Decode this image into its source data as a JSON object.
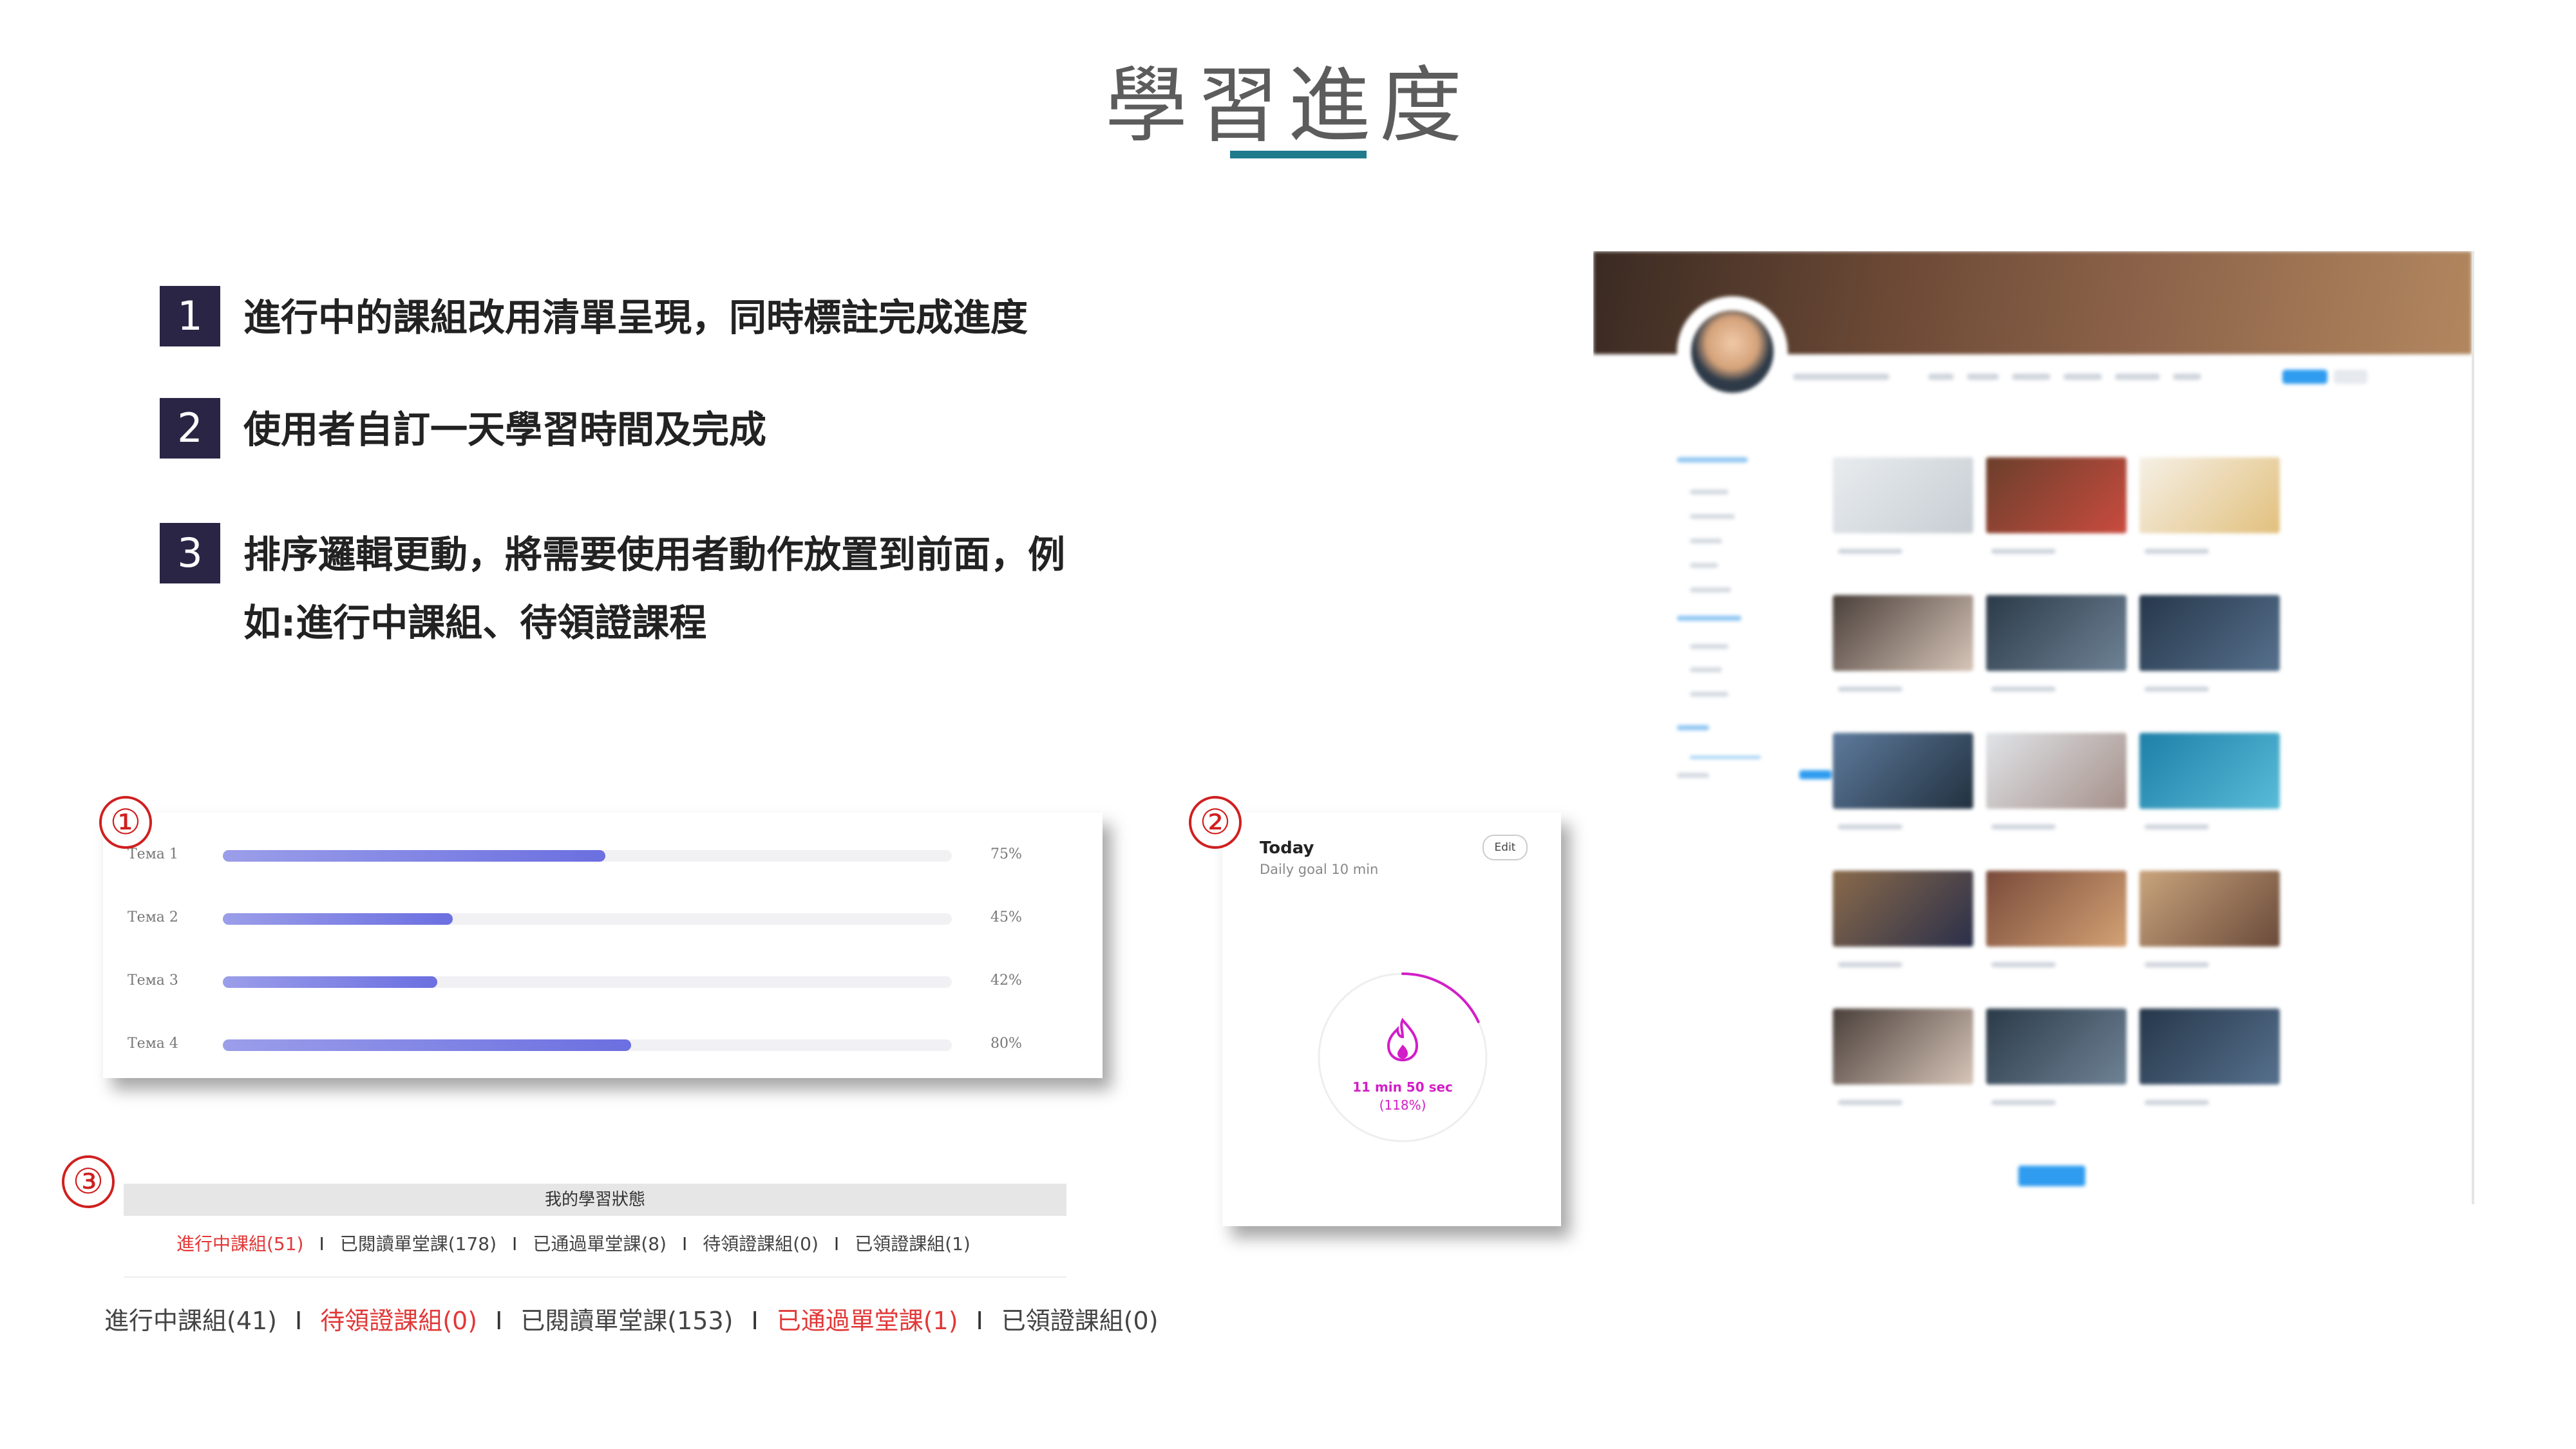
{
  "title": "學習進度",
  "bullets": [
    {
      "num": "1",
      "lines": [
        "進行中的課組改用清單呈現，同時標註完成進度"
      ]
    },
    {
      "num": "2",
      "lines": [
        "使用者自訂一天學習時間及完成"
      ]
    },
    {
      "num": "3",
      "lines": [
        "排序邏輯更動，將需要使用者動作放置到前面，例",
        "如:進行中課組、待領證課程"
      ]
    }
  ],
  "markers": {
    "one": "①",
    "two": "②",
    "three": "③"
  },
  "progress": {
    "rows": [
      {
        "label": "Тема 1",
        "value": 75,
        "pct": "75%"
      },
      {
        "label": "Тема 2",
        "value": 45,
        "pct": "45%"
      },
      {
        "label": "Тема 3",
        "value": 42,
        "pct": "42%"
      },
      {
        "label": "Тема 4",
        "value": 80,
        "pct": "80%"
      }
    ],
    "bar_colors": [
      "#9b9ee9",
      "#6b6fe0"
    ]
  },
  "today": {
    "title": "Today",
    "goal": "Daily goal 10 min",
    "edit_label": "Edit",
    "time": "11 min 50 sec",
    "percent": "(118%)",
    "ring_progress": 0.18,
    "accent": "#d21ec7",
    "icon": "flame-icon"
  },
  "status": {
    "header": "我的學習狀態",
    "old_tabs": [
      {
        "label": "進行中課組(51)",
        "highlight": true
      },
      {
        "label": "已閱讀單堂課(178)",
        "highlight": false
      },
      {
        "label": "已通過單堂課(8)",
        "highlight": false
      },
      {
        "label": "待領證課組(0)",
        "highlight": false
      },
      {
        "label": "已領證課組(1)",
        "highlight": false
      }
    ],
    "new_tabs": [
      {
        "label": "進行中課組(41)",
        "highlight": false
      },
      {
        "label": "待領證課組(0)",
        "highlight": true
      },
      {
        "label": "已閱讀單堂課(153)",
        "highlight": false
      },
      {
        "label": "已通過單堂課(1)",
        "highlight": true
      },
      {
        "label": "已領證課組(0)",
        "highlight": false
      }
    ],
    "separator": "I",
    "highlight_color": "#e23838"
  },
  "colors": {
    "accent_teal": "#1f7a8c",
    "bullet_bg": "#2a2545",
    "marker_red": "#d01f1f"
  }
}
